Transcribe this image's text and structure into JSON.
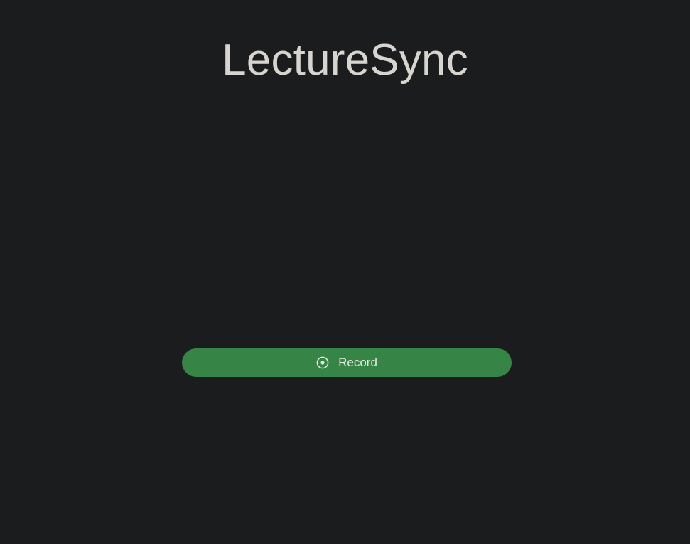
{
  "app": {
    "title": "LectureSync"
  },
  "record_button": {
    "label": "Record",
    "icon": "record-icon"
  },
  "colors": {
    "background": "#1b1c1e",
    "title_text": "#d8d5d0",
    "button_bg": "#378546",
    "button_text": "#e4e8e2"
  }
}
